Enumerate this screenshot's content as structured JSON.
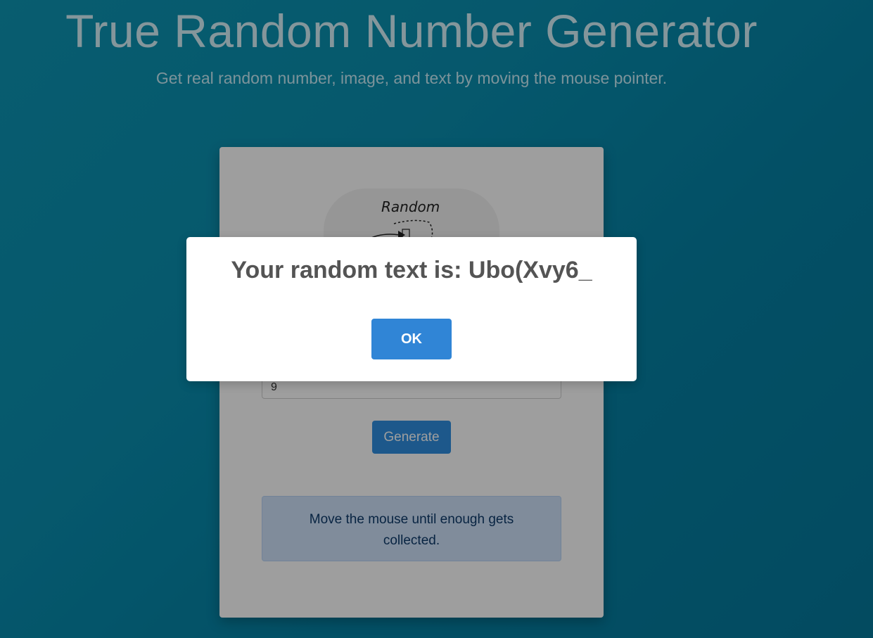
{
  "header": {
    "title": "True Random Number Generator",
    "subtitle": "Get real random number, image, and text by moving the mouse pointer."
  },
  "card": {
    "illustration_label": "Random",
    "length_value": "9",
    "generate_label": "Generate",
    "info_text": "Move the mouse until enough gets collected."
  },
  "modal": {
    "title": "Your random text is: Ubo(Xvy6_",
    "ok_label": "OK"
  },
  "colors": {
    "background": "#0a8fb0",
    "primary_button": "#3085d6",
    "info_bg": "#cfe3fb"
  },
  "icons": {
    "illustration": "mouse-pointer-illustration"
  }
}
